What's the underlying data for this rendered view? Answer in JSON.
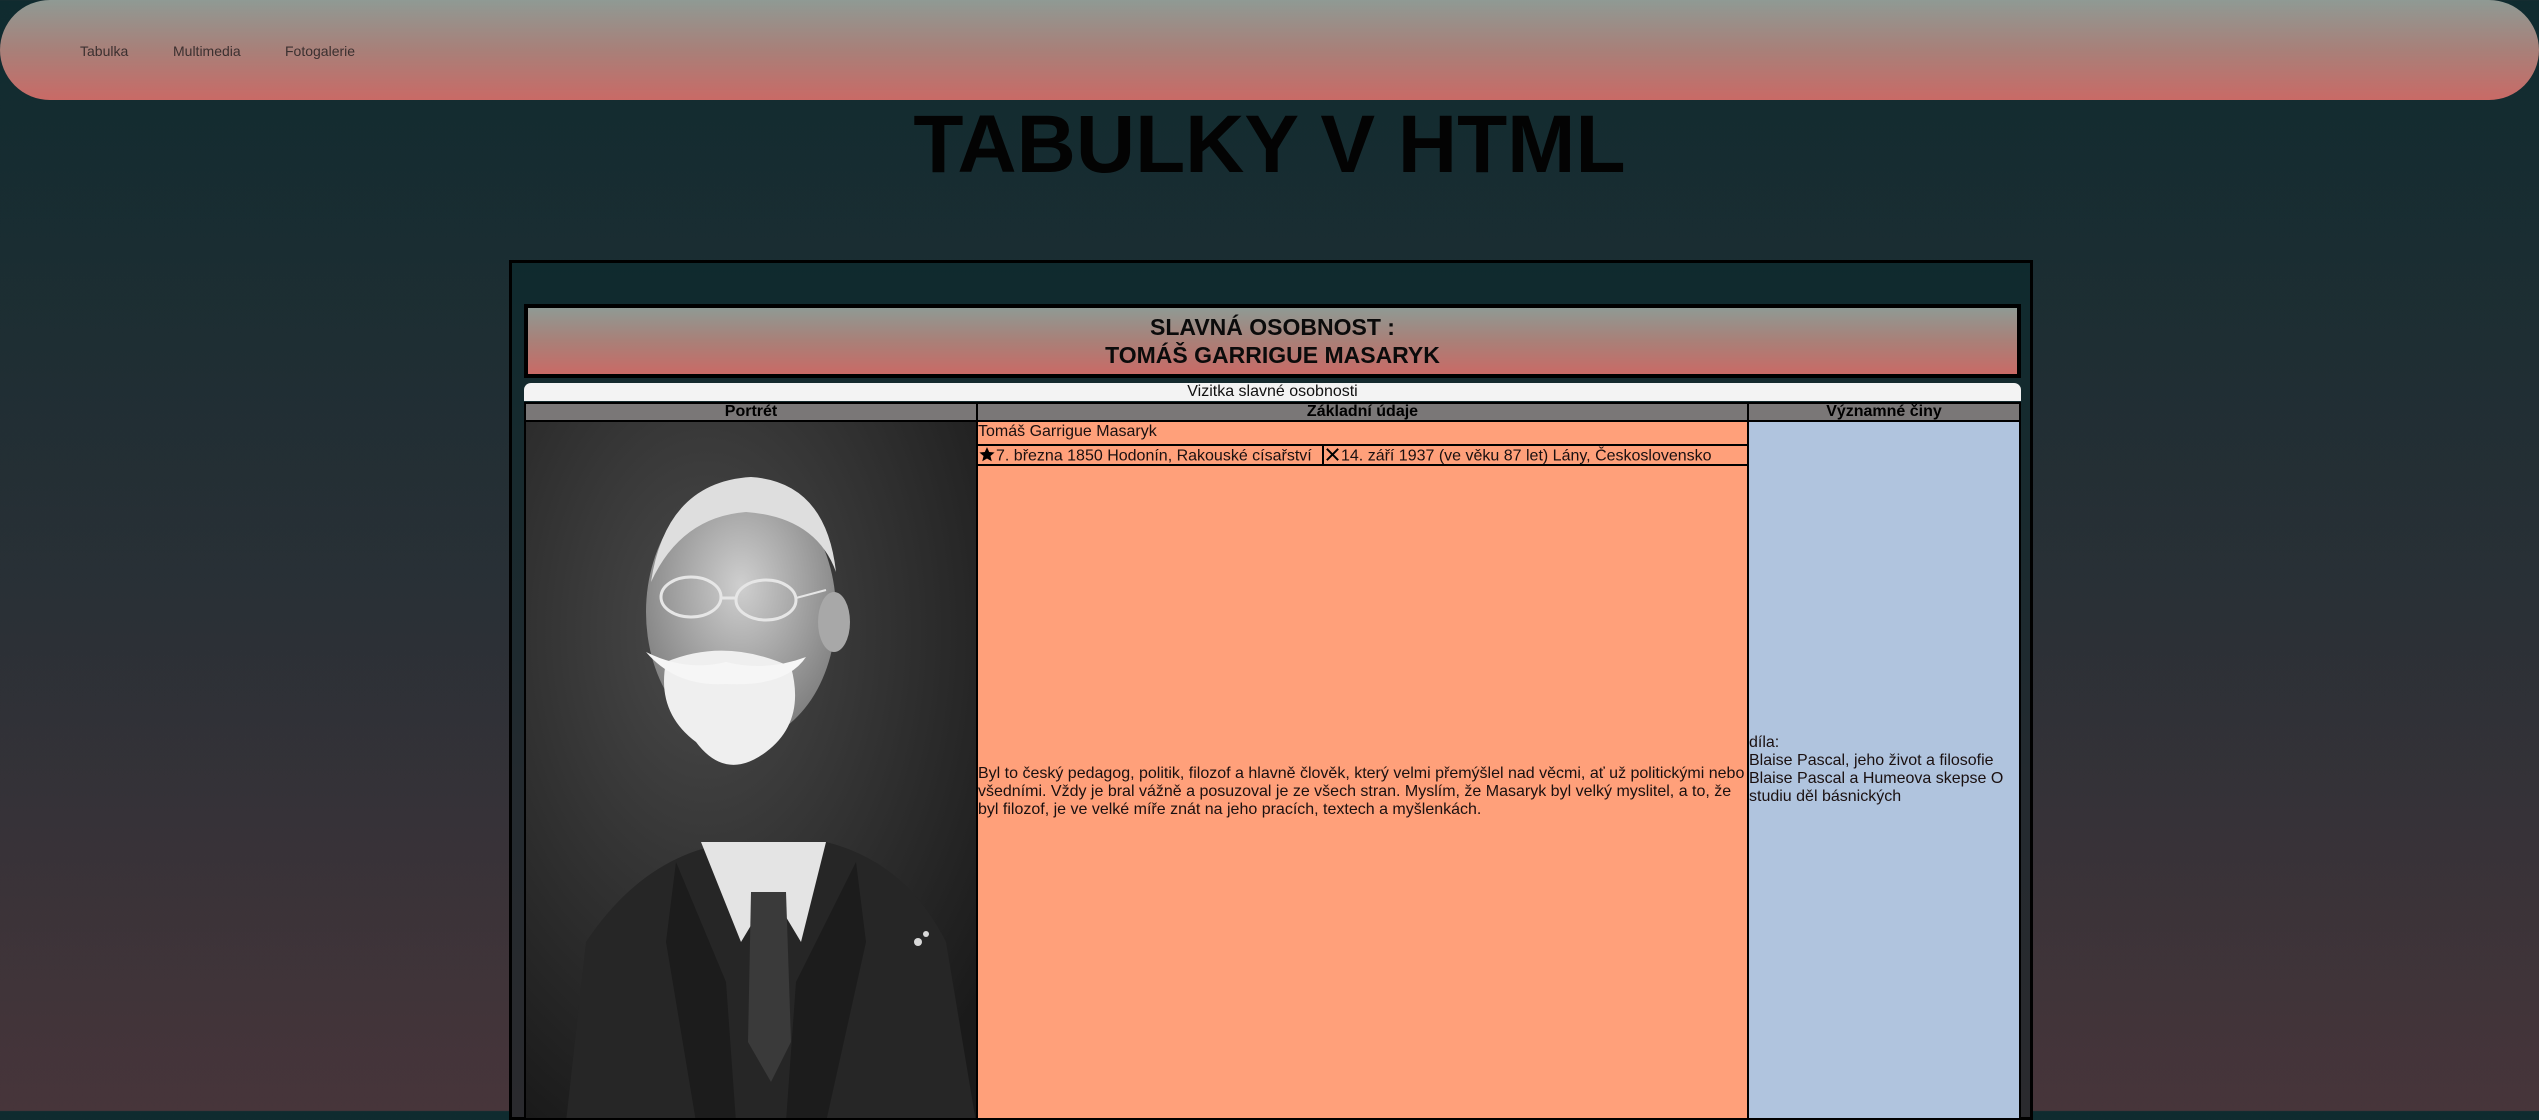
{
  "nav": {
    "items": [
      {
        "label": "Tabulka"
      },
      {
        "label": "Multimedia"
      },
      {
        "label": "Fotogalerie"
      }
    ]
  },
  "page": {
    "title": "TABULKY V HTML"
  },
  "table": {
    "banner_line1": "SLAVNÁ OSOBNOST :",
    "banner_line2": "TOMÁŠ GARRIGUE MASARYK",
    "caption": "Vizitka slavné osobnosti",
    "headers": [
      "Portrét",
      "Základní údaje",
      "Významné činy"
    ],
    "name": "Tomáš Garrigue Masaryk",
    "born": "7. března 1850 Hodonín, Rakouské císařství",
    "died": "14. září 1937 (ve věku 87 let) Lány, Československo",
    "bio": "Byl to český pedagog, politik, filozof a hlavně člověk, který velmi přemýšlel nad věcmi, ať už politickými nebo všedními. Vždy je bral vážně a posuzoval je ze všech stran. Myslím, že Masaryk byl velký myslitel, a to, že byl filozof, je ve velké míře znát na jeho pracích, textech a myšlenkách.",
    "works_label": "díla:",
    "works": [
      "Blaise Pascal, jeho život a filosofie",
      "Blaise Pascal a Humeova skepse O studiu děl básnických"
    ]
  },
  "icons": {
    "born": "star-icon",
    "died": "cross-icon"
  }
}
